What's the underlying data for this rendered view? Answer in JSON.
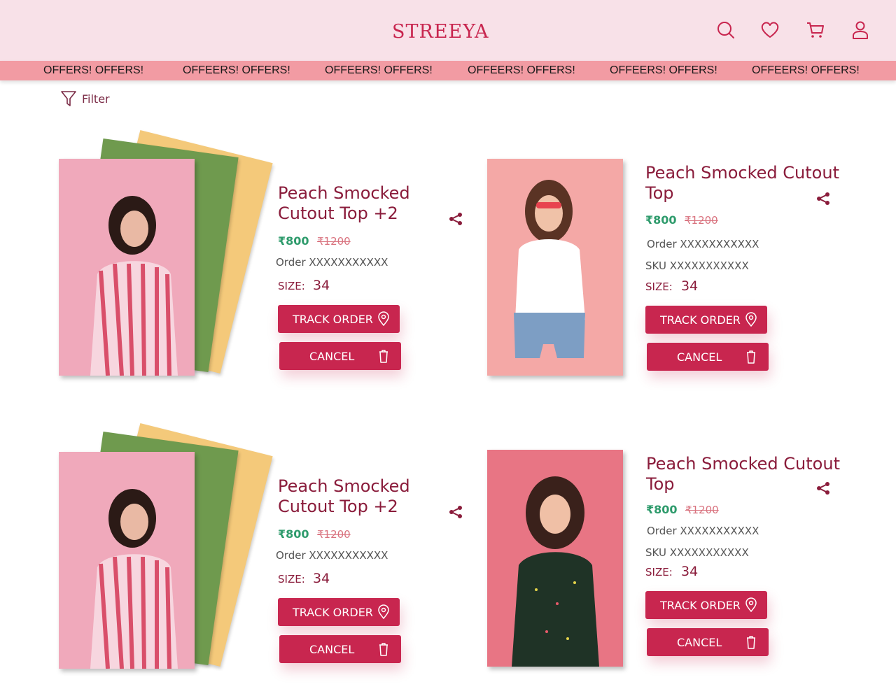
{
  "header": {
    "logo": "STREEYA",
    "icons": [
      "search-icon",
      "heart-icon",
      "cart-icon",
      "user-icon"
    ]
  },
  "offers_bar": [
    "OFFERS! OFFERS!",
    "OFFEERS! OFFERS!",
    "OFFEERS! OFFERS!",
    "OFFEERS! OFFERS!",
    "OFFEERS! OFFERS!",
    "OFFEERS! OFFERS!"
  ],
  "filter": {
    "label": "Filter"
  },
  "colors": {
    "accent": "#c8264f",
    "header_bg": "#f8e1e8",
    "offers_bg": "#f29ba3",
    "price": "#2e9b6c",
    "old_price": "#d9737f",
    "title": "#8a1c3b"
  },
  "orders": [
    {
      "title": "Peach Smocked Cutout Top +2",
      "price": "₹800",
      "old_price": "₹1200",
      "order": "Order XXXXXXXXXXX",
      "size_label": "SIZE:",
      "size": "34",
      "track_label": "TRACK ORDER",
      "cancel_label": "CANCEL"
    },
    {
      "title": "Peach Smocked Cutout Top",
      "price": "₹800",
      "old_price": "₹1200",
      "order": "Order XXXXXXXXXXX",
      "sku": "SKU XXXXXXXXXXX",
      "size_label": "SIZE:",
      "size": "34",
      "track_label": "TRACK ORDER",
      "cancel_label": "CANCEL"
    },
    {
      "title": "Peach Smocked Cutout Top +2",
      "price": "₹800",
      "old_price": "₹1200",
      "order": "Order XXXXXXXXXXX",
      "size_label": "SIZE:",
      "size": "34",
      "track_label": "TRACK ORDER",
      "cancel_label": "CANCEL"
    },
    {
      "title": "Peach Smocked Cutout Top",
      "price": "₹800",
      "old_price": "₹1200",
      "order": "Order XXXXXXXXXXX",
      "sku": "SKU XXXXXXXXXXX",
      "size_label": "SIZE:",
      "size": "34",
      "track_label": "TRACK ORDER",
      "cancel_label": "CANCEL"
    }
  ]
}
